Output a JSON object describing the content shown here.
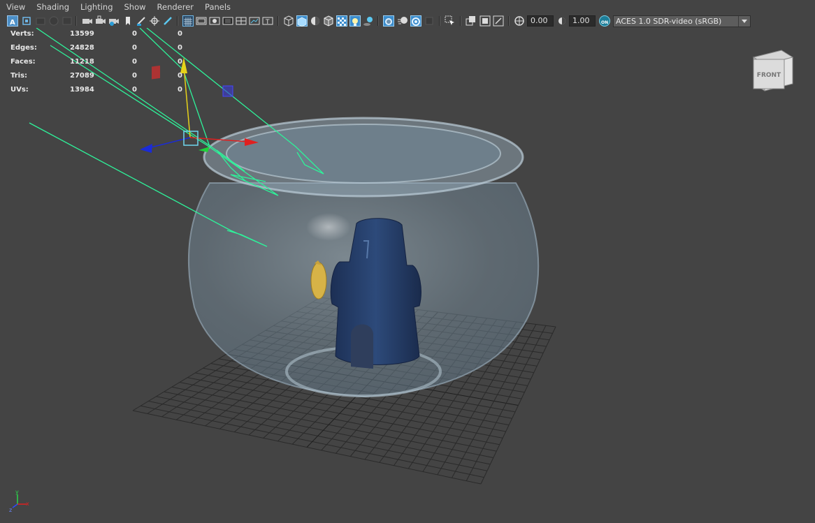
{
  "menubar": {
    "items": [
      "View",
      "Shading",
      "Lighting",
      "Show",
      "Renderer",
      "Panels"
    ]
  },
  "toolbar": {
    "exposure_value": "0.00",
    "gamma_value": "1.00",
    "color_management_badge": "ON",
    "color_space": "ACES 1.0 SDR-video (sRGB)",
    "icons": [
      "select-camera",
      "camera-attributes",
      "bookmarks",
      "image-plane",
      "2d-pan-zoom",
      "grease-pencil",
      "grid",
      "film-gate",
      "resolution-gate",
      "gate-mask",
      "field-chart",
      "safe-action",
      "safe-title",
      "wireframe",
      "smooth-shade",
      "default-material",
      "wireframe-on-shaded",
      "xray",
      "use-all-lights",
      "shadows",
      "screen-space-ao",
      "motion-blur",
      "multisample-aa",
      "depth-of-field",
      "isolate-select",
      "xray-joints",
      "xray-active",
      "exposure",
      "gamma",
      "color-management"
    ]
  },
  "hud": {
    "rows": [
      {
        "label": "Verts:",
        "v1": "13599",
        "v2": "0",
        "v3": "0"
      },
      {
        "label": "Edges:",
        "v1": "24828",
        "v2": "0",
        "v3": "0"
      },
      {
        "label": "Faces:",
        "v1": "11218",
        "v2": "0",
        "v3": "0"
      },
      {
        "label": "Tris:",
        "v1": "27089",
        "v2": "0",
        "v3": "0"
      },
      {
        "label": "UVs:",
        "v1": "13984",
        "v2": "0",
        "v3": "0"
      }
    ]
  },
  "viewcube": {
    "face_label": "FRONT"
  },
  "axis_indicator": {
    "y": "y",
    "x": "x",
    "z": "z"
  },
  "colors": {
    "background": "#444444",
    "bowl_glass": "#8fa6b6",
    "house": "#243a64",
    "fish": "#d7b347",
    "light_lines": "#2ef29a",
    "manip_x": "#e02020",
    "manip_y": "#e6d21a",
    "manip_z": "#1a2bd8"
  }
}
